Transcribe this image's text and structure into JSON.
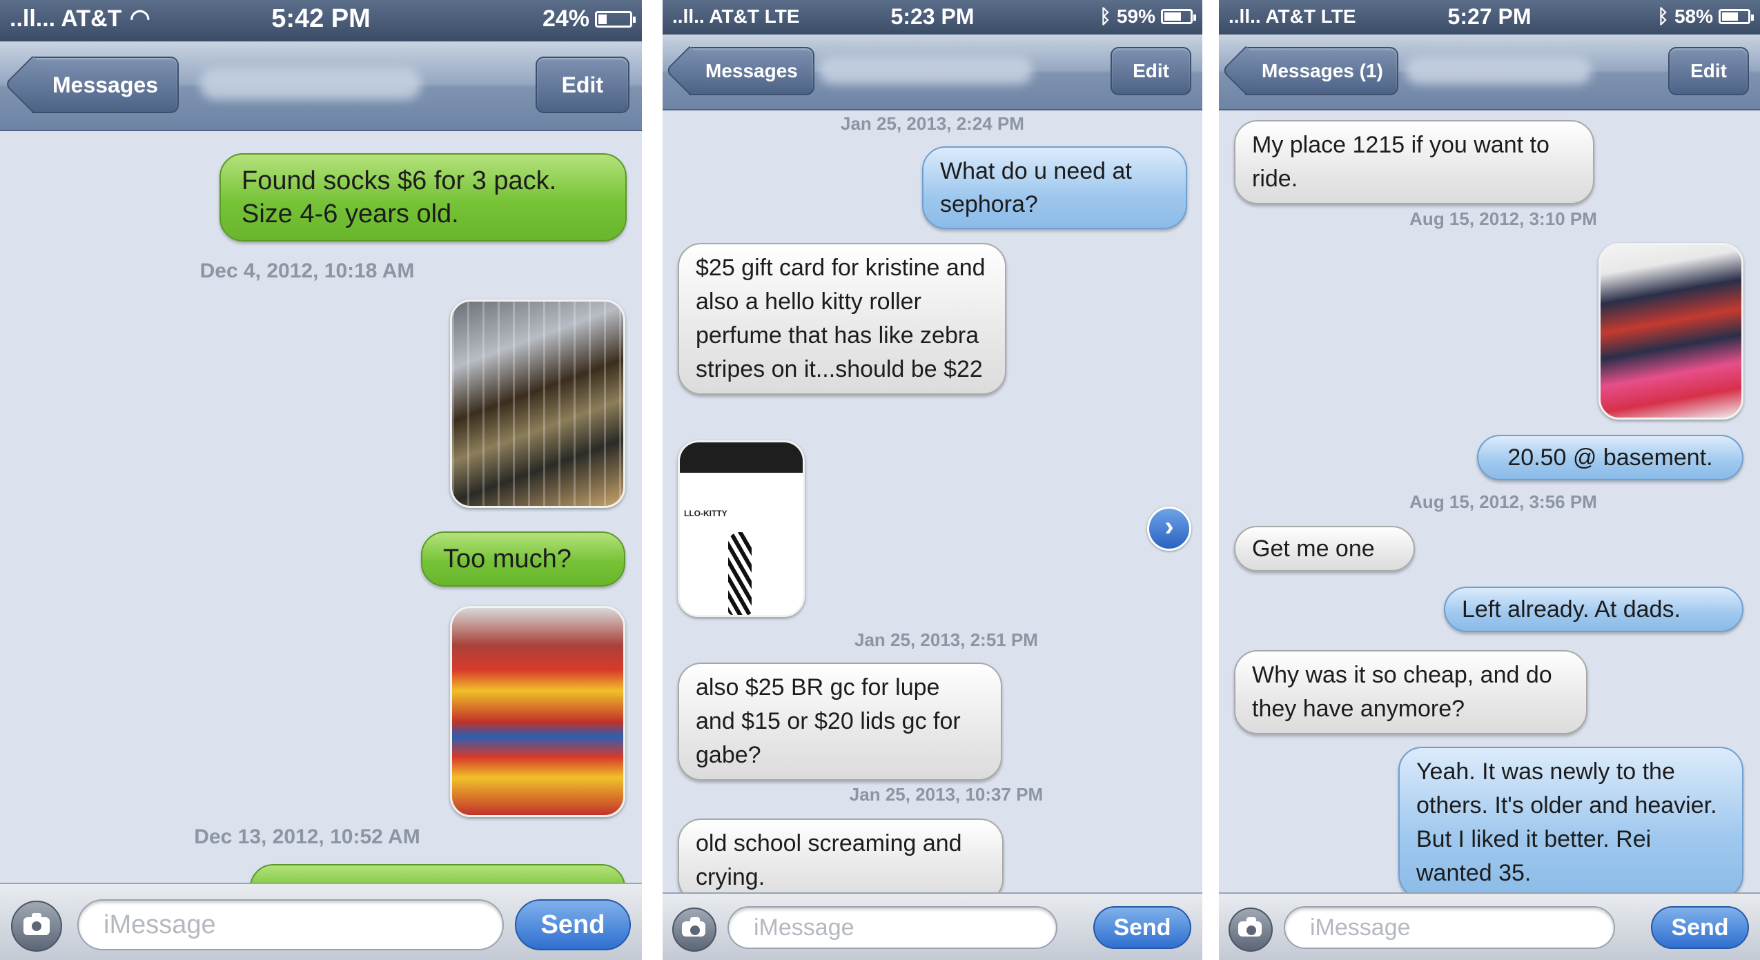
{
  "screens": [
    {
      "status": {
        "carrier": "..ll... AT&T",
        "time": "5:42 PM",
        "battery": "24%",
        "battery_level": 0.24
      },
      "nav": {
        "back": "Messages",
        "edit": "Edit"
      },
      "messages": {
        "m1": "Found socks $6 for 3 pack. Size 4-6 years old.",
        "ts1": "Dec 4, 2012, 10:18 AM",
        "m2": "Too much?",
        "ts2": "Dec 13, 2012, 10:52 AM"
      },
      "input": {
        "placeholder": "iMessage",
        "send": "Send"
      }
    },
    {
      "status": {
        "carrier": "..ll.. AT&T LTE",
        "time": "5:23 PM",
        "battery": "59%",
        "battery_level": 0.59
      },
      "nav": {
        "back": "Messages",
        "edit": "Edit"
      },
      "messages": {
        "ts1": "Jan 25, 2013, 2:24 PM",
        "m1": "What do u need at sephora?",
        "m2": "$25 gift card for kristine and also a hello kitty roller perfume that has like zebra stripes on it...should be $22",
        "ts2": "Jan 25, 2013, 2:51 PM",
        "m3": "also $25 BR gc for lupe and $15 or $20 lids gc for gabe?",
        "ts3": "Jan 25, 2013, 10:37 PM",
        "m4": "old school screaming and crying."
      },
      "input": {
        "placeholder": "iMessage",
        "send": "Send"
      }
    },
    {
      "status": {
        "carrier": "..ll.. AT&T LTE",
        "time": "5:27 PM",
        "battery": "58%",
        "battery_level": 0.58
      },
      "nav": {
        "back": "Messages (1)",
        "edit": "Edit"
      },
      "messages": {
        "m1": "My place 1215 if you want to ride.",
        "ts1": "Aug 15, 2012, 3:10 PM",
        "m2": "20.50 @ basement.",
        "ts2": "Aug 15, 2012, 3:56 PM",
        "m3": "Get me one",
        "m4": "Left already. At dads.",
        "m5": "Why was it so cheap, and do they have anymore?",
        "m6": "Yeah. It was newly to the others. It's older and heavier. But I liked it better. Rei wanted 35."
      },
      "input": {
        "placeholder": "iMessage",
        "send": "Send"
      }
    }
  ]
}
